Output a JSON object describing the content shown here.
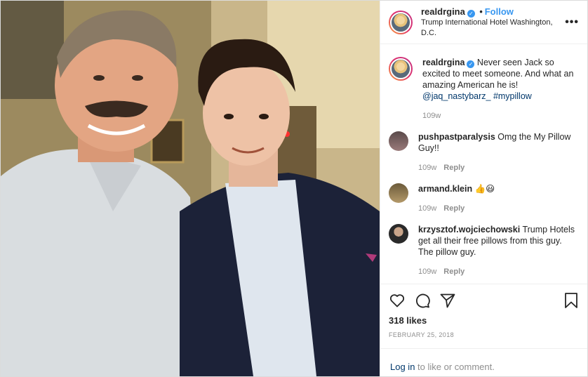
{
  "post": {
    "photo_alt": "",
    "author": "realdrgina",
    "separator": "•",
    "follow_label": "Follow",
    "location": "Trump International Hotel Washington, D.C.",
    "more_label": "•••",
    "caption": {
      "username": "realdrgina",
      "text": "Never seen Jack so excited to meet someone. And what an amazing American he is!",
      "tags": "@jaq_nastybarz_ #mypillow",
      "time": "109w"
    },
    "comments": [
      {
        "username": "pushpastparalysis",
        "text": "Omg the My Pillow Guy!!",
        "time": "109w",
        "reply": "Reply"
      },
      {
        "username": "armand.klein",
        "text": "👍😃",
        "time": "109w",
        "reply": "Reply"
      },
      {
        "username": "krzysztof.wojciechowski",
        "text": "Trump Hotels get all their free pillows from this guy. The pillow guy.",
        "time": "109w",
        "reply": "Reply"
      }
    ],
    "likes": "318 likes",
    "date": "FEBRUARY 25, 2018",
    "login_link": "Log in",
    "login_text": " to like or comment.",
    "colors": {
      "link": "#00376b",
      "follow": "#3897f0",
      "verified": "#3897f0",
      "muted": "#8e8e8e"
    },
    "icons": [
      "heart-icon",
      "comment-icon",
      "share-icon",
      "bookmark-icon",
      "verified-icon",
      "more-icon"
    ]
  }
}
